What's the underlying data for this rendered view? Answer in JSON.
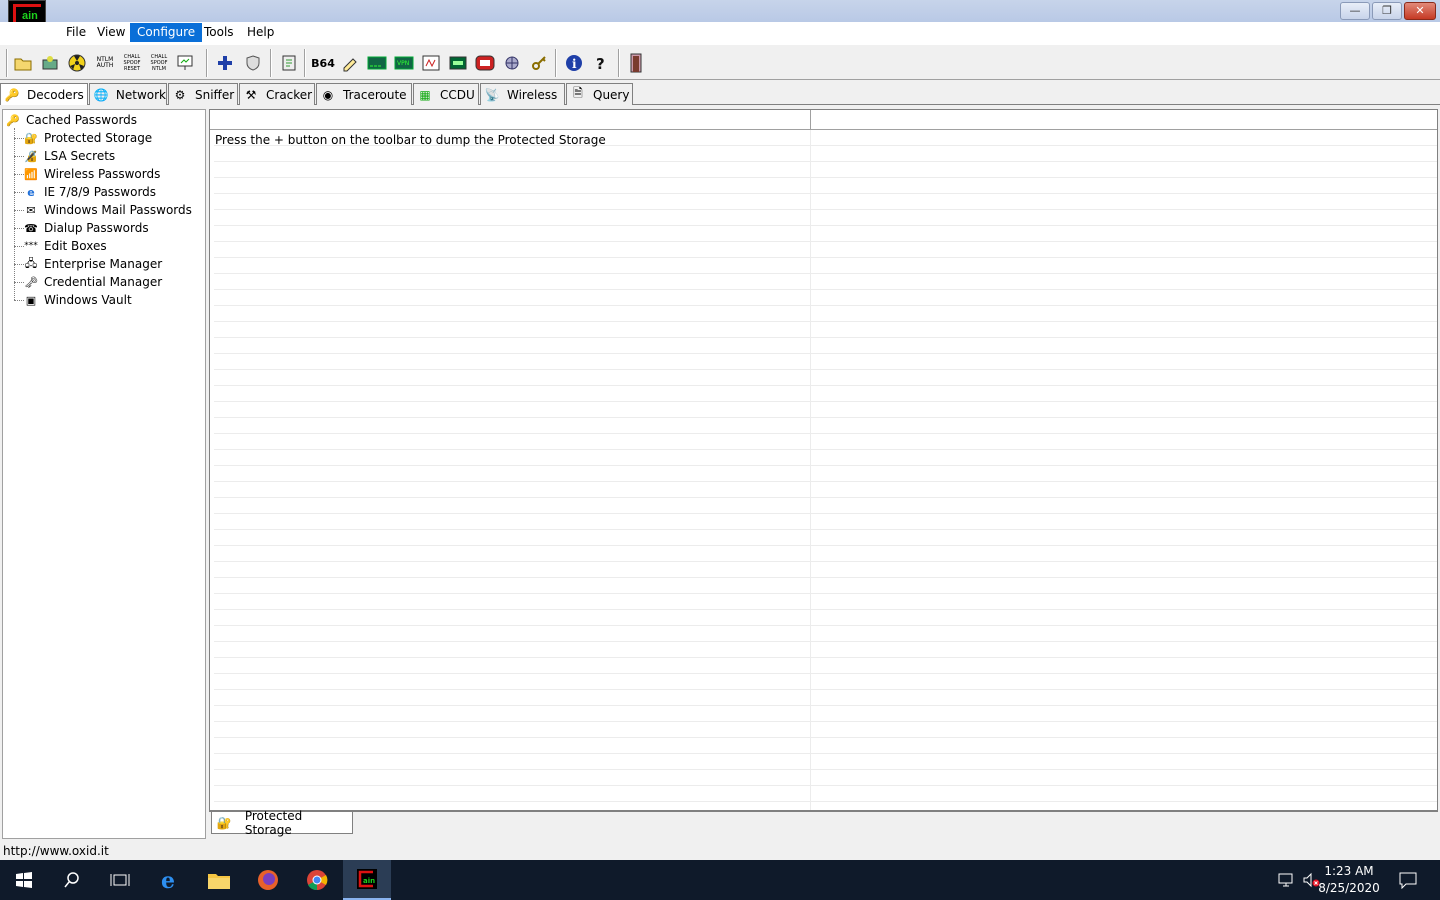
{
  "window": {
    "minimize": "—",
    "restore": "❐",
    "close": "✕"
  },
  "app_logo_text": "ain",
  "menu": [
    {
      "label": "File"
    },
    {
      "label": "View"
    },
    {
      "label": "Configure"
    },
    {
      "label": "Tools"
    },
    {
      "label": "Help"
    }
  ],
  "toolbar_labels": {
    "ntlm_auth": "NTLM AUTH",
    "chall_spoof_reset": "CHALL SPOOF RESET",
    "chall_spoof_ntlm": "CHALL SPOOF NTLM",
    "b64": "B64"
  },
  "tabs": [
    {
      "label": "Decoders"
    },
    {
      "label": "Network"
    },
    {
      "label": "Sniffer"
    },
    {
      "label": "Cracker"
    },
    {
      "label": "Traceroute"
    },
    {
      "label": "CCDU"
    },
    {
      "label": "Wireless"
    },
    {
      "label": "Query"
    }
  ],
  "tree": {
    "root": "Cached Passwords",
    "children": [
      "Protected Storage",
      "LSA Secrets",
      "Wireless Passwords",
      "IE 7/8/9 Passwords",
      "Windows Mail Passwords",
      "Dialup Passwords",
      "Edit Boxes",
      "Enterprise Manager",
      "Credential Manager",
      "Windows Vault"
    ]
  },
  "list": {
    "message": "Press the + button on the toolbar to dump the Protected Storage"
  },
  "bottom_tab": "Protected Storage",
  "status": "http://www.oxid.it",
  "clock": {
    "time": "1:23 AM",
    "date": "8/25/2020"
  },
  "colors": {
    "menu_active": "#0a6fd8",
    "taskbar": "#0f1a2a"
  }
}
